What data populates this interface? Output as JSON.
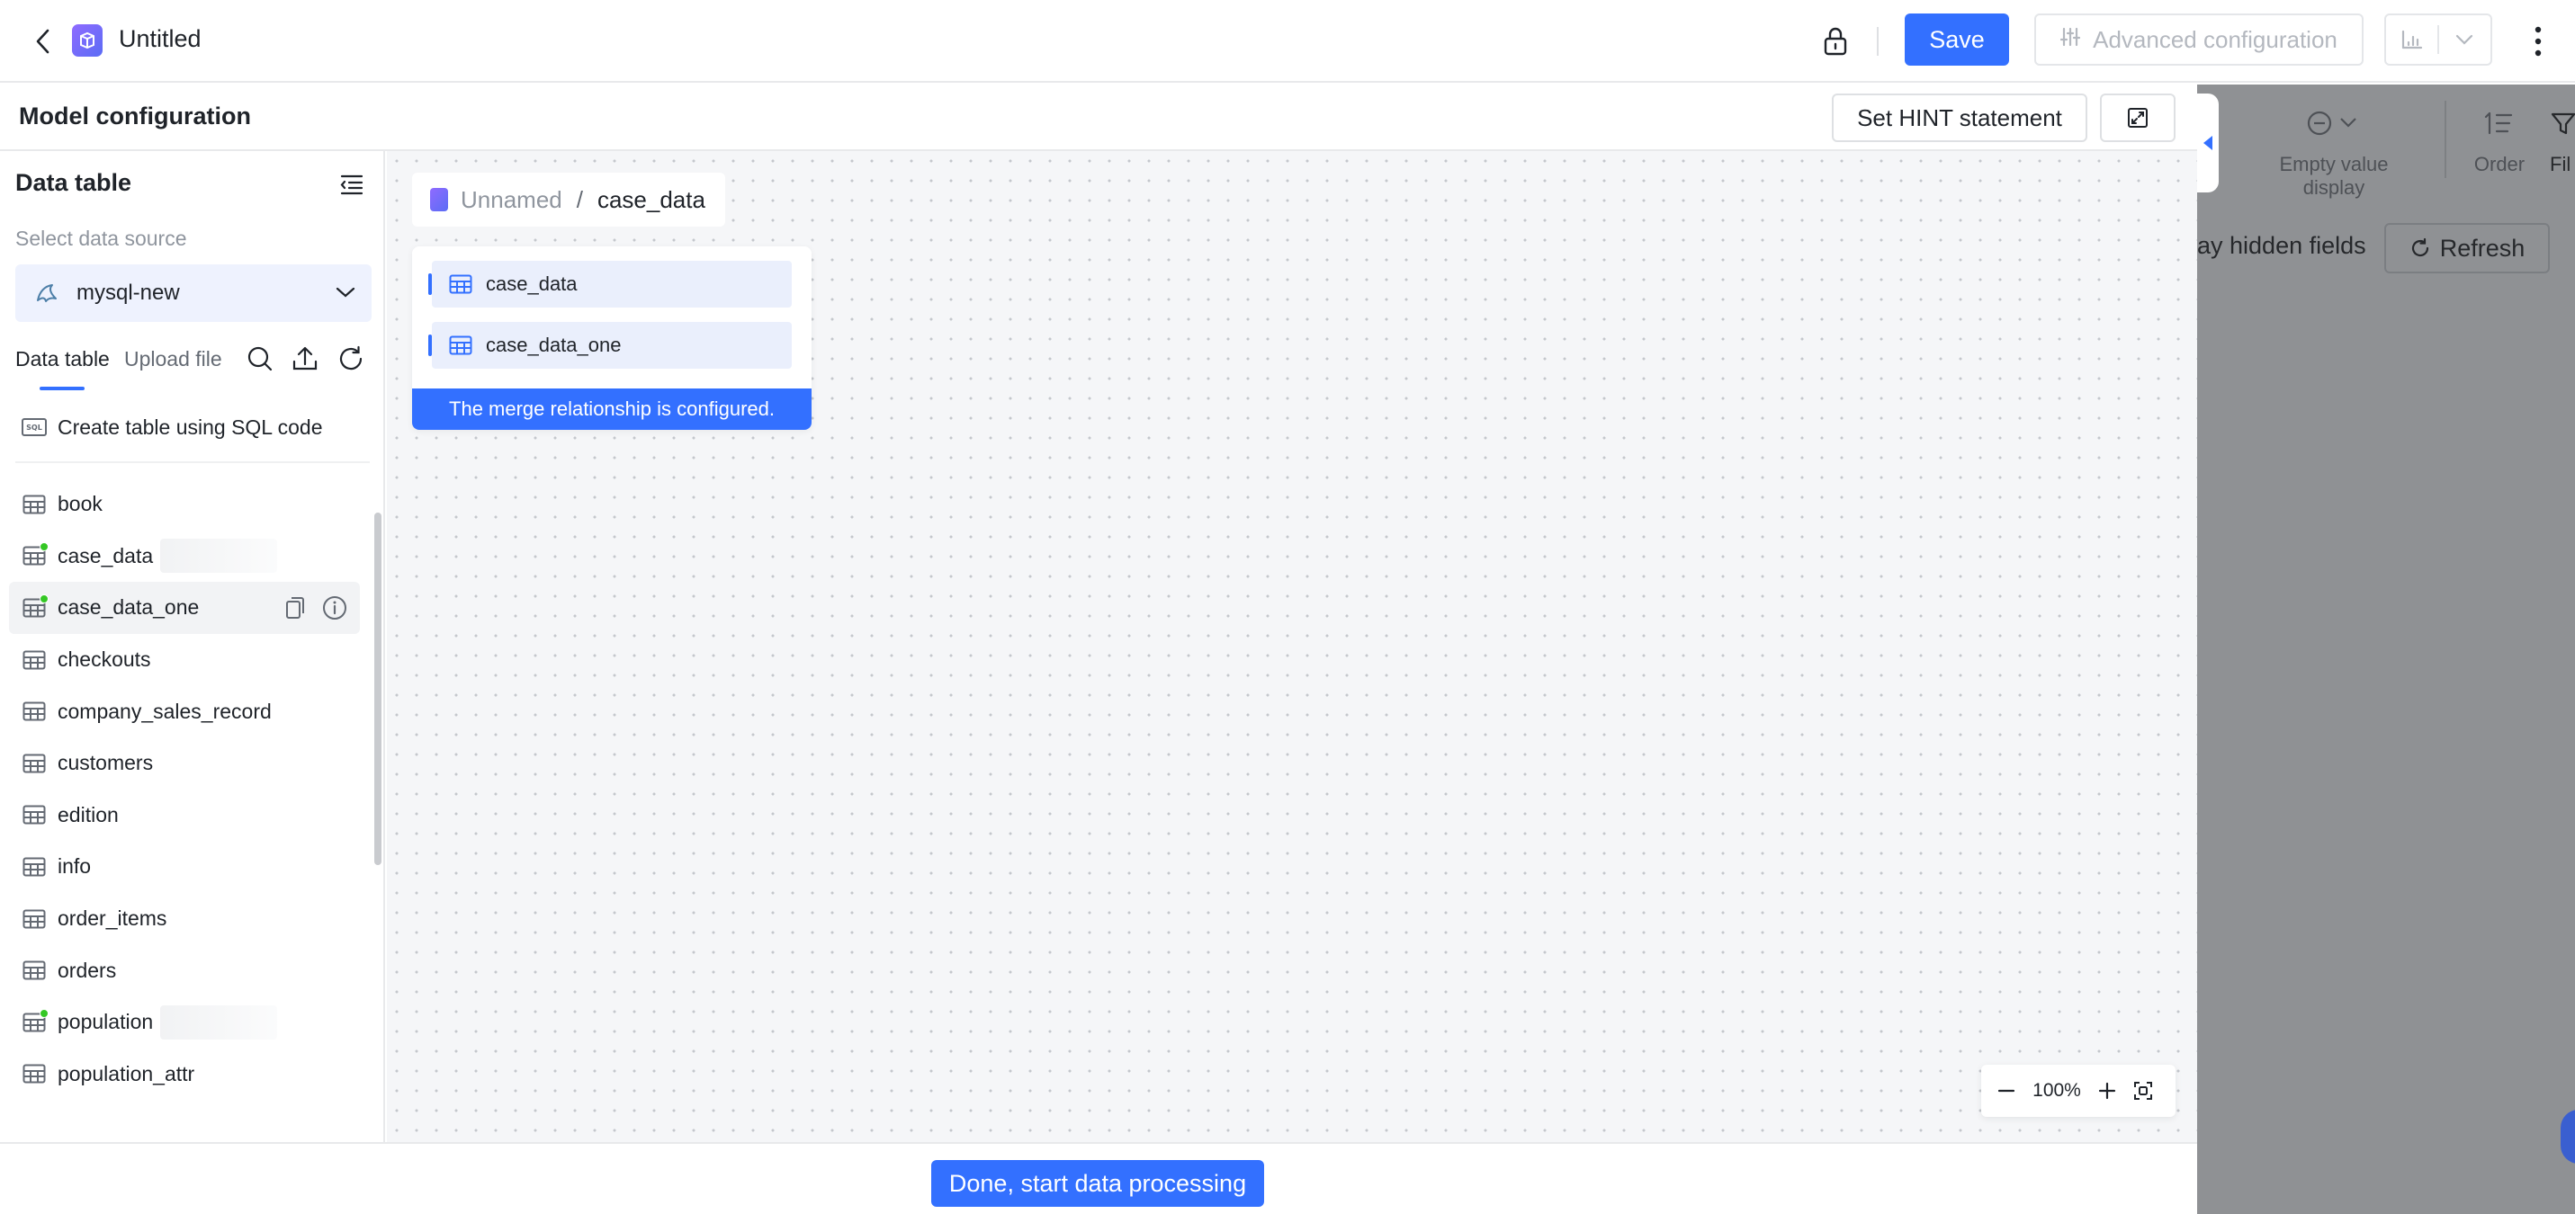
{
  "header": {
    "title": "Untitled",
    "save_label": "Save",
    "advanced_label": "Advanced configuration"
  },
  "model_config": {
    "title": "Model configuration",
    "hint_label": "Set HINT statement"
  },
  "sidebar": {
    "title": "Data table",
    "source_label": "Select data source",
    "source_value": "mysql-new",
    "tabs": [
      {
        "label": "Data table",
        "active": true
      },
      {
        "label": "Upload file",
        "active": false
      }
    ],
    "sql_label": "Create table using SQL code",
    "tables": [
      {
        "name": "book",
        "in_use": false
      },
      {
        "name": "case_data",
        "in_use": true
      },
      {
        "name": "case_data_one",
        "in_use": true,
        "hovered": true
      },
      {
        "name": "checkouts",
        "in_use": false
      },
      {
        "name": "company_sales_record",
        "in_use": false
      },
      {
        "name": "customers",
        "in_use": false
      },
      {
        "name": "edition",
        "in_use": false
      },
      {
        "name": "info",
        "in_use": false
      },
      {
        "name": "order_items",
        "in_use": false
      },
      {
        "name": "orders",
        "in_use": false
      },
      {
        "name": "population",
        "in_use": true
      },
      {
        "name": "population_attr",
        "in_use": false
      }
    ]
  },
  "canvas": {
    "breadcrumb_root": "Unnamed",
    "breadcrumb_sep": "/",
    "breadcrumb_current": "case_data",
    "nodes": [
      "case_data",
      "case_data_one"
    ],
    "merge_message": "The merge relationship is configured.",
    "zoom_level": "100%"
  },
  "right_panel": {
    "empty_value_label": "Empty value display",
    "order_label": "Order",
    "filter_label": "Fil",
    "hidden_fields_label": "ay hidden fields",
    "refresh_label": "Refresh"
  },
  "footer": {
    "done_label": "Done, start data processing"
  },
  "colors": {
    "accent": "#3370ff",
    "in_use_dot": "#34c724",
    "canvas_bg": "#f5f6f8",
    "overlay": "#8f9194"
  }
}
